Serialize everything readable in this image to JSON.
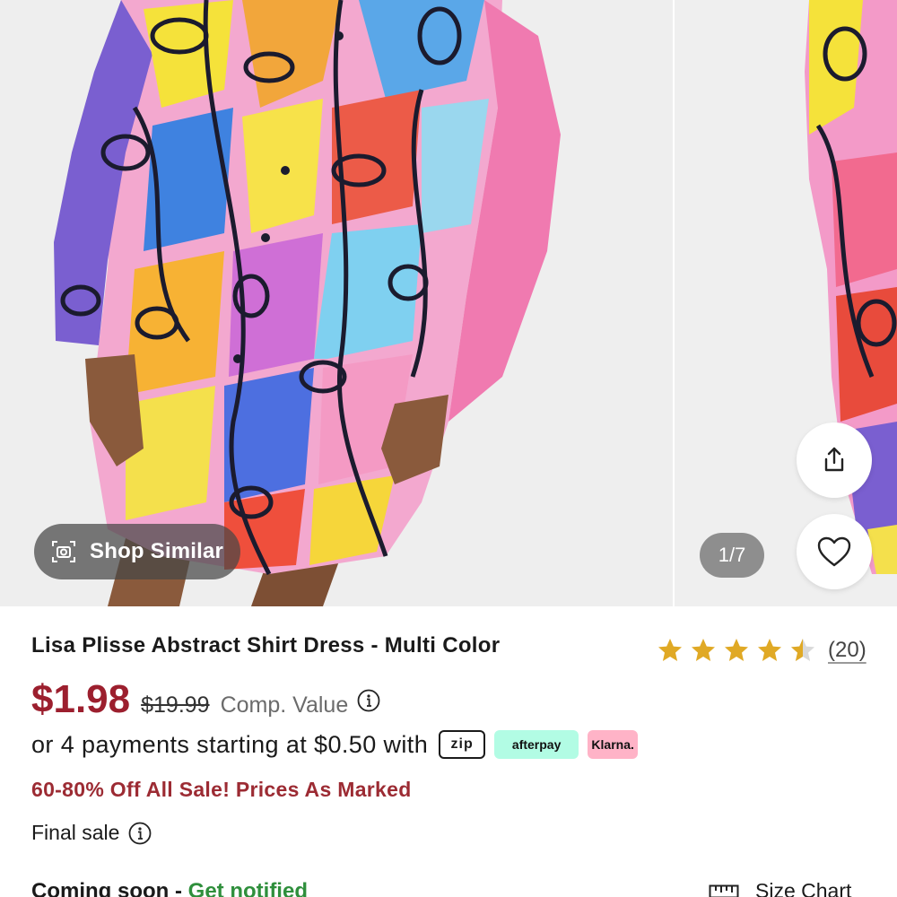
{
  "gallery": {
    "shop_similar_label": "Shop Similar",
    "counter": "1/7",
    "icons": {
      "camera": "camera-scan-icon",
      "share": "share-icon",
      "favorite": "heart-icon"
    }
  },
  "product": {
    "title": "Lisa Plisse Abstract Shirt Dress - Multi Color",
    "rating": 4.5,
    "review_count": "(20)",
    "price": "$1.98",
    "original_price": "$19.99",
    "comp_value_label": "Comp. Value",
    "payments_text": "or 4 payments starting at $0.50 with",
    "payment_providers": {
      "zip": "zip",
      "afterpay": "afterpay",
      "klarna": "Klarna."
    },
    "sale_text": "60-80% Off All Sale! Prices As Marked",
    "final_sale_label": "Final sale",
    "coming_soon_label": "Coming soon -",
    "get_notified_label": "Get notified",
    "size_chart_label": "Size Chart"
  },
  "colors": {
    "price": "#9c1f2e",
    "sale": "#9c2b33",
    "notify": "#2f8f3c",
    "star": "#e0a925",
    "afterpay": "#b2fce4",
    "klarna": "#ffb3c7"
  }
}
